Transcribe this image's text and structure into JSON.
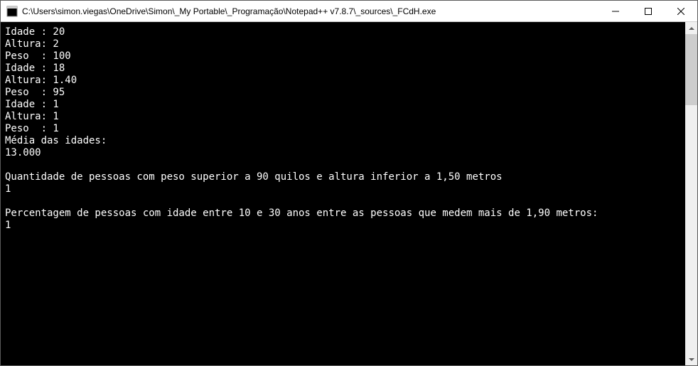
{
  "window": {
    "title": "C:\\Users\\simon.viegas\\OneDrive\\Simon\\_My Portable\\_Programação\\Notepad++ v7.8.7\\_sources\\_FCdH.exe"
  },
  "console": {
    "entries": [
      {
        "idade": "20",
        "altura": "2",
        "peso": "100"
      },
      {
        "idade": "18",
        "altura": "1.40",
        "peso": "95"
      },
      {
        "idade": "1",
        "altura": "1",
        "peso": "1"
      }
    ],
    "labels": {
      "idade": "Idade : ",
      "altura": "Altura: ",
      "peso": "Peso  : "
    },
    "media_label": "Média das idades:",
    "media_value": "13.000",
    "quant_label": "Quantidade de pessoas com peso superior a 90 quilos e altura inferior a 1,50 metros",
    "quant_value": "1",
    "perc_label": "Percentagem de pessoas com idade entre 10 e 30 anos entre as pessoas que medem mais de 1,90 metros:",
    "perc_value": "1"
  }
}
